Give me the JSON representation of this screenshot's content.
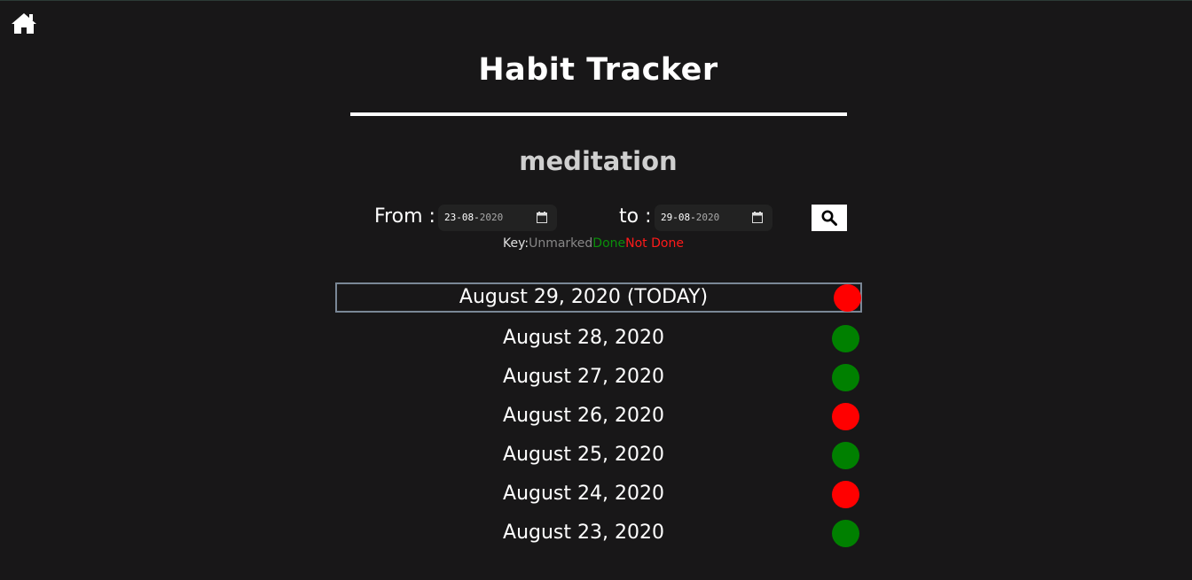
{
  "app": {
    "title": "Habit Tracker",
    "habit_name": "meditation"
  },
  "filter": {
    "from_label": "From :",
    "from_date": {
      "day_month": "23-08-",
      "year": "2020"
    },
    "to_label": "to :",
    "to_date": {
      "day_month": "29-08-",
      "year": "2020"
    }
  },
  "key": {
    "label": "Key:",
    "unmarked": "Unmarked",
    "done": "Done",
    "not_done": "Not Done"
  },
  "colors": {
    "done": "#008000",
    "not_done": "#ff0000",
    "unmarked": "#888888"
  },
  "days": [
    {
      "label": "August 29, 2020 (TODAY)",
      "status": "not_done",
      "today": true
    },
    {
      "label": "August 28, 2020",
      "status": "done",
      "today": false
    },
    {
      "label": "August 27, 2020",
      "status": "done",
      "today": false
    },
    {
      "label": "August 26, 2020",
      "status": "not_done",
      "today": false
    },
    {
      "label": "August 25, 2020",
      "status": "done",
      "today": false
    },
    {
      "label": "August 24, 2020",
      "status": "not_done",
      "today": false
    },
    {
      "label": "August 23, 2020",
      "status": "done",
      "today": false
    }
  ],
  "icons": {
    "home": "home-icon",
    "search": "search-icon",
    "calendar": "calendar-icon"
  }
}
